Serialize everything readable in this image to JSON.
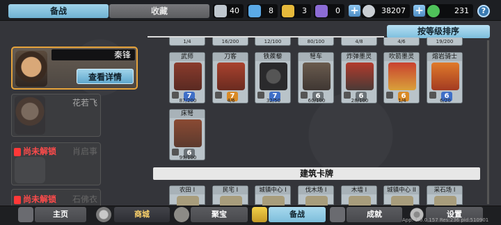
{
  "tabs": {
    "prepare": "备战",
    "collection": "收藏"
  },
  "resources": [
    {
      "icon": "silver-shield-icon",
      "value": "40",
      "color": "#bfc7cf"
    },
    {
      "icon": "blue-shield-icon",
      "value": "8",
      "color": "#5aa9e6"
    },
    {
      "icon": "gold-shield-icon",
      "value": "3",
      "color": "#e6b93b"
    },
    {
      "icon": "purple-shield-icon",
      "value": "0",
      "color": "#8c6cd6"
    },
    {
      "icon": "coin-icon",
      "value": "38207",
      "color": "#c9ced4"
    },
    {
      "icon": "gem-icon",
      "value": "231",
      "color": "#4fc25a"
    }
  ],
  "sort_button": "按等级排序",
  "heroes": [
    {
      "name": "秦锋",
      "button": "查看详情"
    },
    {
      "name": "花若飞"
    },
    {
      "locked": "尚未解锁",
      "name": "肖启事"
    },
    {
      "locked": "尚未解锁",
      "name": "石佛衣"
    }
  ],
  "top_partial_cards": [
    "1/4",
    "16/200",
    "12/100",
    "80/100",
    "4/8",
    "4/6",
    "19/200"
  ],
  "unit_cards": [
    {
      "name": "武师",
      "level": "7",
      "progress": "87/200",
      "color": "#3f6fc7"
    },
    {
      "name": "刀客",
      "level": "7",
      "progress": "4/6",
      "color": "#d98a26"
    },
    {
      "name": "铁蒺藜",
      "level": "7",
      "progress": "32/50",
      "color": "#3f6fc7"
    },
    {
      "name": "弩车",
      "level": "6",
      "progress": "60/100",
      "color": "#6b7277"
    },
    {
      "name": "炸弹墨灵",
      "level": "6",
      "progress": "28/100",
      "color": "#6b7277"
    },
    {
      "name": "吹箭墨灵",
      "level": "6",
      "progress": "1/4",
      "color": "#d98a26"
    },
    {
      "name": "熔岩骑士",
      "level": "6",
      "progress": "6/20",
      "color": "#3f6fc7"
    },
    {
      "name": "床弩",
      "level": "6",
      "progress": "99/100",
      "color": "#6b7277"
    }
  ],
  "section_title": "建筑卡牌",
  "building_cards": [
    "农田 I",
    "民宅 I",
    "城镇中心 I",
    "伐木场 I",
    "木墙 I",
    "城镇中心 II",
    "采石场 I"
  ],
  "nav": [
    "主页",
    "商城",
    "聚宝",
    "备战",
    "成就",
    "设置"
  ],
  "version": "App: 1.0.0.157 Res:236 pid:510901"
}
